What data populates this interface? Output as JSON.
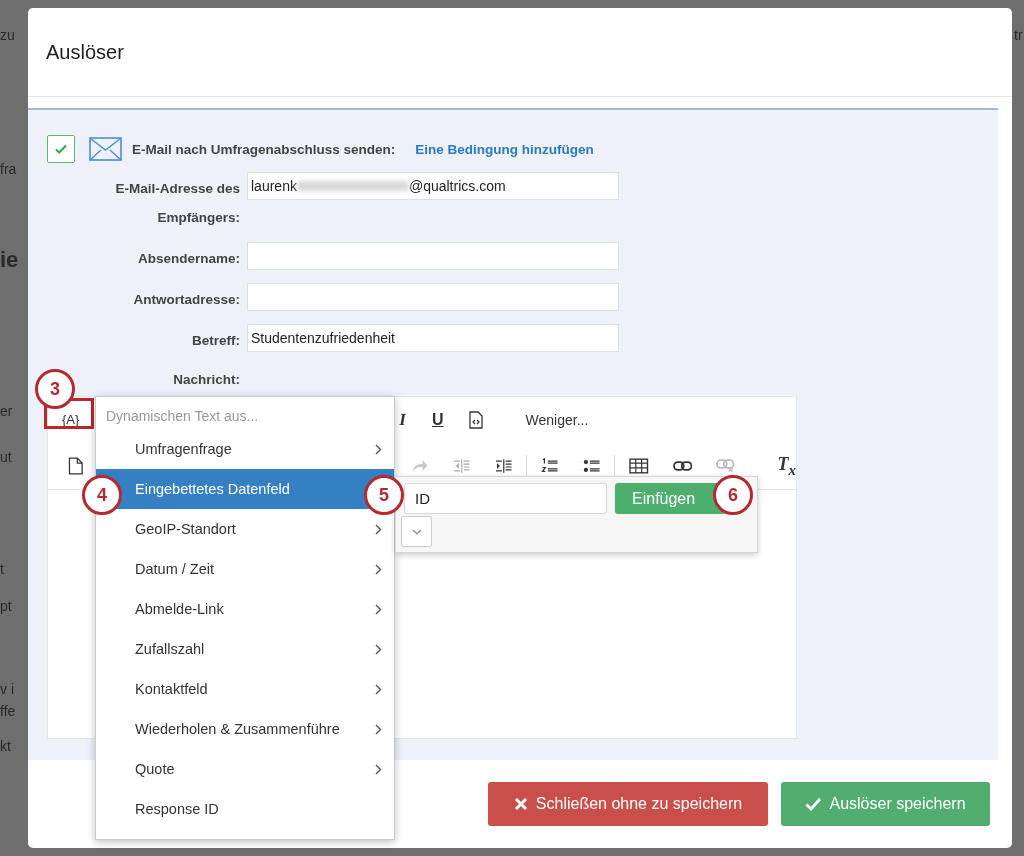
{
  "background_fragments": [
    "zu",
    "fra",
    "ie",
    "er",
    "ut",
    "t",
    "pt",
    "v i",
    "ffe",
    "kt",
    "tr"
  ],
  "dialog": {
    "title": "Auslöser",
    "email_toggle": {
      "checked": true,
      "label": "E-Mail nach Umfragenabschluss senden:",
      "link": "Eine Bedingung hinzufügen"
    },
    "fields": [
      {
        "label": "E-Mail-Adresse des Empfängers:",
        "value_start": "laurenk",
        "value_end": "@qualtrics.com",
        "blurred": true
      },
      {
        "label": "Absendername:"
      },
      {
        "label": "Antwortadresse:"
      },
      {
        "label": "Betreff:",
        "value_start": "Studentenzufriedenheit"
      }
    ],
    "message_label": "Nachricht:",
    "toolbar_row_1": [
      {
        "kind": "text",
        "text": "{A}"
      },
      {
        "kind": "italic",
        "text": "I"
      },
      {
        "kind": "underline",
        "text": "U"
      },
      {
        "kind": "source"
      },
      {
        "kind": "text",
        "text": "Weniger..."
      }
    ],
    "toolbar_row_2": [
      {
        "kind": "document"
      },
      {
        "kind": "redo"
      },
      {
        "kind": "outdent"
      },
      {
        "kind": "indent"
      },
      {
        "kind": "ordered-list"
      },
      {
        "kind": "bullet-list"
      },
      {
        "kind": "table"
      },
      {
        "kind": "link"
      },
      {
        "kind": "unlink"
      },
      {
        "kind": "text",
        "text": "T$_{x}$"
      }
    ],
    "buttons": [
      {
        "kind": "cancel",
        "label": "Schließen ohne zu speichern"
      },
      {
        "kind": "save",
        "label": "Auslöser speichern"
      }
    ]
  },
  "dynamic_text_menu": {
    "header": "Dynamischen Text aus...",
    "items": [
      {
        "label": "Umfragenfrage",
        "selected": false,
        "submenu": true
      },
      {
        "label": "Eingebettetes Datenfeld",
        "selected": true
      },
      {
        "label": "GeoIP-Standort",
        "selected": false,
        "submenu": true
      },
      {
        "label": "Datum / Zeit",
        "selected": false,
        "submenu": true
      },
      {
        "label": "Abmelde-Link",
        "selected": false,
        "submenu": true
      },
      {
        "label": "Zufallszahl",
        "selected": false,
        "submenu": true
      },
      {
        "label": "Kontaktfeld",
        "selected": false,
        "submenu": true
      },
      {
        "label": "Wiederholen & Zusammenführe",
        "selected": false,
        "submenu": true
      },
      {
        "label": "Quote",
        "selected": false,
        "submenu": true
      },
      {
        "label": "Response ID",
        "selected": false
      }
    ]
  },
  "embedded_field_popup": {
    "value": "ID",
    "button": "Einfügen"
  },
  "callouts": [
    "3",
    "4",
    "5",
    "6"
  ]
}
